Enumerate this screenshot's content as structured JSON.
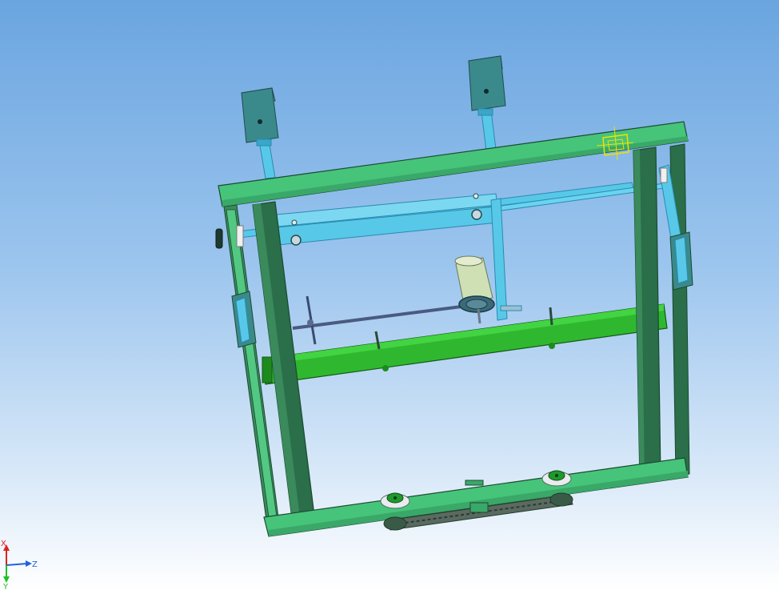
{
  "viewport": {
    "background_top": "#6aa5e0",
    "background_bottom": "#ffffff"
  },
  "colors": {
    "frame_light": "#46c47a",
    "frame_mid": "#3aa868",
    "frame_dark": "#2a6e4a",
    "frame_edge": "#1b4a30",
    "cyan_rail": "#58c8e8",
    "cyan_dark": "#2a8ab0",
    "box_teal": "#3a8a8c",
    "box_dark": "#2b6466",
    "bar_green": "#2fb82f",
    "motor_body": "#cfe0b4",
    "selection": "#f0e000"
  },
  "triad": {
    "x_label": "X",
    "y_label": "Y",
    "z_label": "Z",
    "x_color": "#e02020",
    "y_color": "#20c020",
    "z_color": "#2060e0"
  }
}
